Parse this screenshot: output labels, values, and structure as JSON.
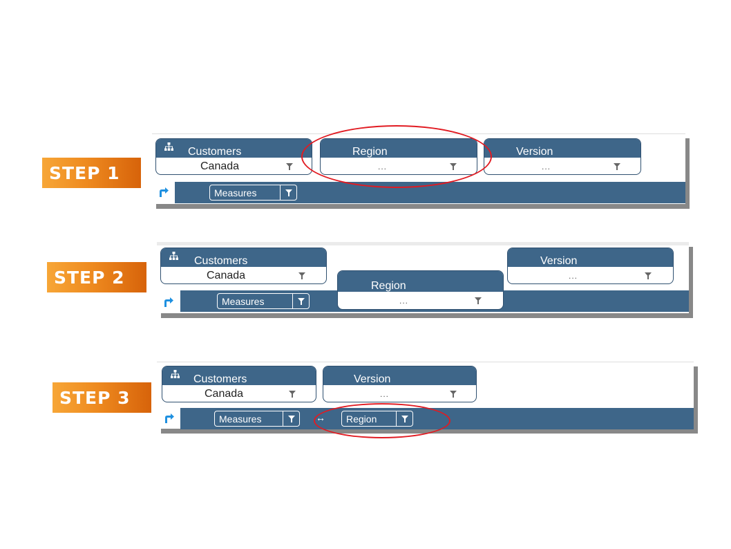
{
  "colors": {
    "header_blue": "#3e6689",
    "badge_orange": "#ee8a1f",
    "highlight_red": "#e11b22",
    "swap_icon_blue": "#1e90e0"
  },
  "steps": [
    {
      "badge": "STEP 1",
      "dims": {
        "customers": {
          "name": "Customers",
          "value": "Canada"
        },
        "region": {
          "name": "Region",
          "value": "..."
        },
        "version": {
          "name": "Version",
          "value": "..."
        }
      },
      "row_chips": {
        "measures": "Measures"
      },
      "highlight": "Region"
    },
    {
      "badge": "STEP 2",
      "dims": {
        "customers": {
          "name": "Customers",
          "value": "Canada"
        },
        "region": {
          "name": "Region",
          "value": "..."
        },
        "version": {
          "name": "Version",
          "value": "..."
        }
      },
      "row_chips": {
        "measures": "Measures"
      }
    },
    {
      "badge": "STEP 3",
      "dims": {
        "customers": {
          "name": "Customers",
          "value": "Canada"
        },
        "version": {
          "name": "Version",
          "value": "..."
        }
      },
      "row_chips": {
        "measures": "Measures",
        "region": "Region"
      },
      "highlight": "Region"
    }
  ],
  "icons": {
    "hierarchy": "hierarchy-icon",
    "filter": "filter-icon",
    "swap": "swap-axes-icon",
    "arrows": "left-right-arrow-icon"
  }
}
